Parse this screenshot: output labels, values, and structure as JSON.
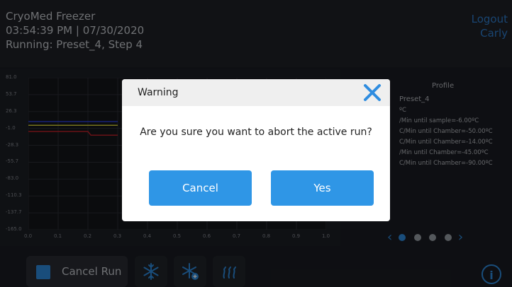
{
  "header": {
    "device": "CryoMed Freezer",
    "datetime": "03:54:39 PM | 07/30/2020",
    "status": "Running: Preset_4, Step 4",
    "logout": "Logout",
    "user": "Carly"
  },
  "chart_data": {
    "type": "line",
    "yticks": [
      "81.0",
      "53.7",
      "26.3",
      "-1.0",
      "-28.3",
      "-55.7",
      "-83.0",
      "-110.3",
      "-137.7",
      "-165.0"
    ],
    "xticks": [
      "0.0",
      "0.1",
      "0.2",
      "0.3",
      "0.4",
      "0.5",
      "0.6",
      "0.7",
      "0.8",
      "0.9",
      "1.0"
    ],
    "ylim": [
      -165.0,
      81.0
    ],
    "xlim": [
      0.0,
      1.0
    ],
    "series": [
      {
        "color": "#2a3fd8",
        "points": [
          [
            0.0,
            10
          ],
          [
            0.3,
            10
          ]
        ]
      },
      {
        "color": "#d7d23a",
        "points": [
          [
            0.0,
            4
          ],
          [
            0.3,
            4
          ]
        ]
      },
      {
        "color": "#c2222a",
        "points": [
          [
            0.0,
            -6
          ],
          [
            0.2,
            -6
          ],
          [
            0.21,
            -12
          ],
          [
            0.3,
            -12
          ]
        ]
      }
    ]
  },
  "profile": {
    "title": "Profile",
    "name": "Preset_4",
    "steps": [
      "ºC",
      "/Min until sample=-6.00ºC",
      "C/Min until Chamber=-50.00ºC",
      "C/Min until Chamber=-14.00ºC",
      "/Min until Chamber=-45.00ºC",
      "C/Min until Chamber=-90.00ºC"
    ]
  },
  "pager": {
    "prev": "‹",
    "next": "›",
    "dots": 4,
    "active": 0
  },
  "footer": {
    "cancel_run": "Cancel Run",
    "info": "i"
  },
  "icons": {
    "tool1": "snowflake-icon",
    "tool2": "snowflake-plus-icon",
    "tool3": "heat-icon"
  },
  "dialog": {
    "title": "Warning",
    "message": "Are you sure you want to abort the active run?",
    "cancel": "Cancel",
    "confirm": "Yes"
  },
  "colors": {
    "accent": "#2f96e6",
    "title_blue": "#2f7fd0"
  }
}
